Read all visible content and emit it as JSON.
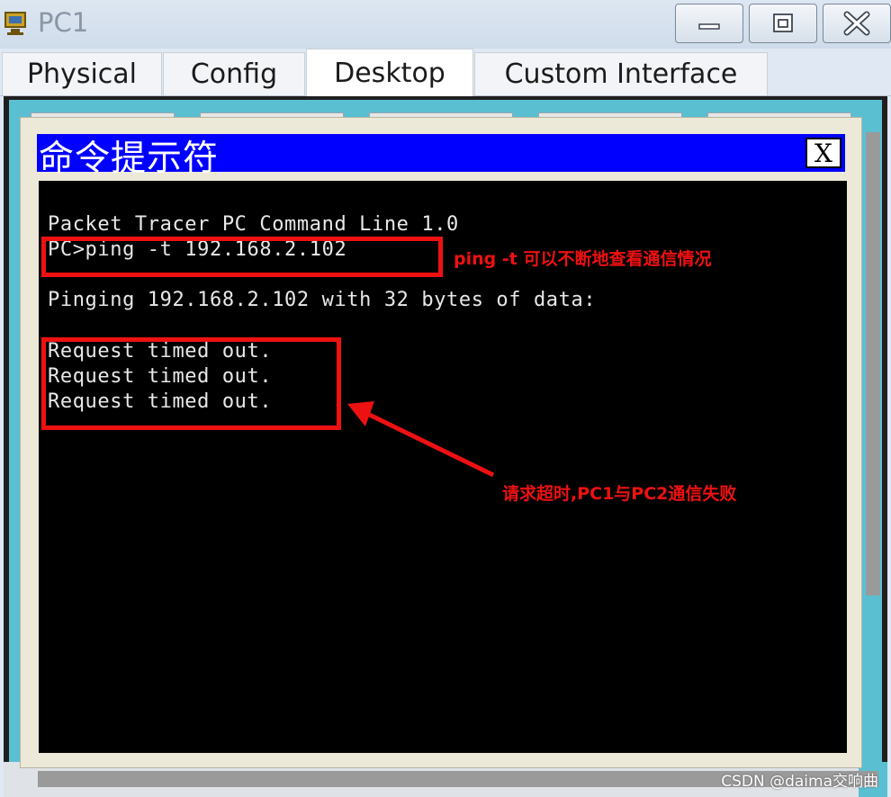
{
  "window": {
    "title": "PC1",
    "icon": "packet-tracer-pc-icon",
    "controls": [
      "minimize-icon",
      "maximize-icon",
      "close-icon"
    ]
  },
  "tabs": [
    {
      "label": "Physical",
      "active": false
    },
    {
      "label": "Config",
      "active": false
    },
    {
      "label": "Desktop",
      "active": true
    },
    {
      "label": "Custom Interface",
      "active": false
    }
  ],
  "command_prompt": {
    "title": "命令提示符",
    "close_label": "X",
    "lines": [
      "Packet Tracer PC Command Line 1.0",
      "PC>ping -t 192.168.2.102",
      "",
      "Pinging 192.168.2.102 with 32 bytes of data:",
      "",
      "Request timed out.",
      "Request timed out.",
      "Request timed out."
    ]
  },
  "annotations": {
    "ping_note": "ping -t  可以不断地查看通信情况",
    "timeout_note": "请求超时,PC1与PC2通信失败",
    "color": "#ee1111"
  },
  "watermark": "CSDN @daima交响曲",
  "colors": {
    "cmd_title_bar": "#0000ff",
    "terminal_bg": "#000000",
    "desktop_bg": "#5bbfd2"
  }
}
